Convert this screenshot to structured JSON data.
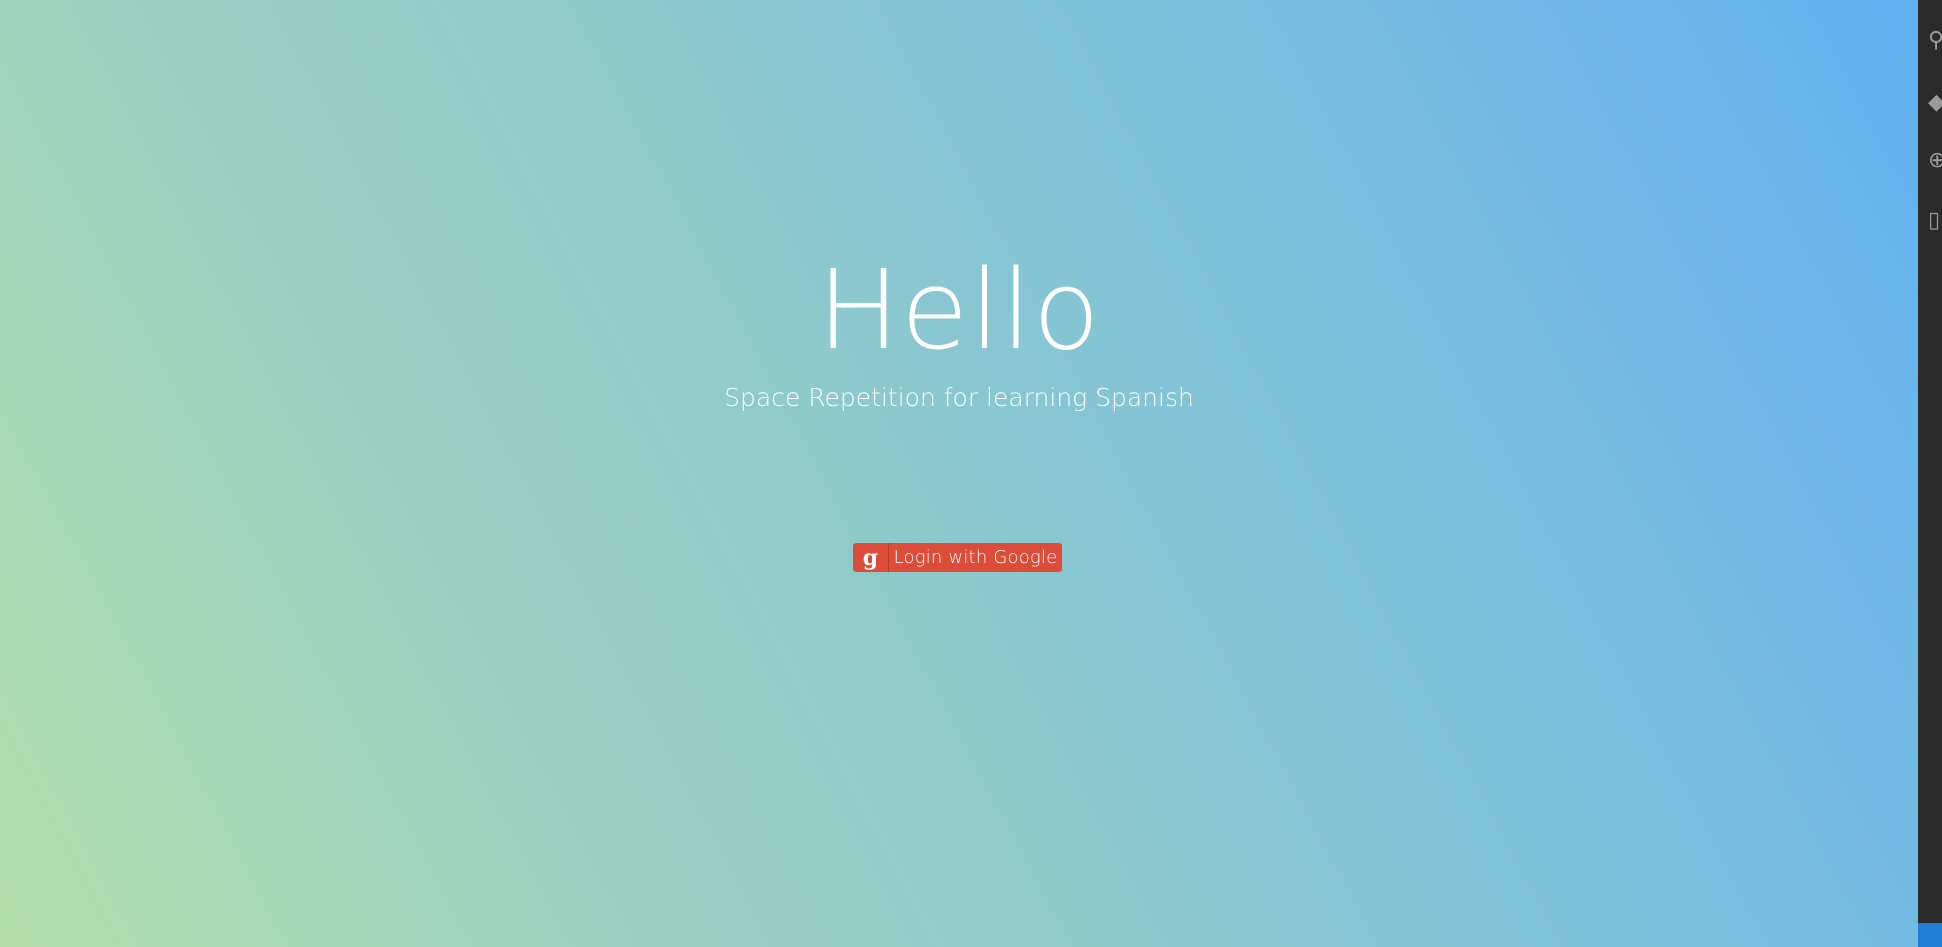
{
  "hero": {
    "title": "Hello",
    "subtitle": "Space Repetition for learning Spanish"
  },
  "login": {
    "icon_letter": "g",
    "label": "Login with Google",
    "color": "#dd4b39"
  },
  "side_toolbar": {
    "icons": [
      "search-icon",
      "pin-icon",
      "globe-icon",
      "document-icon"
    ]
  }
}
